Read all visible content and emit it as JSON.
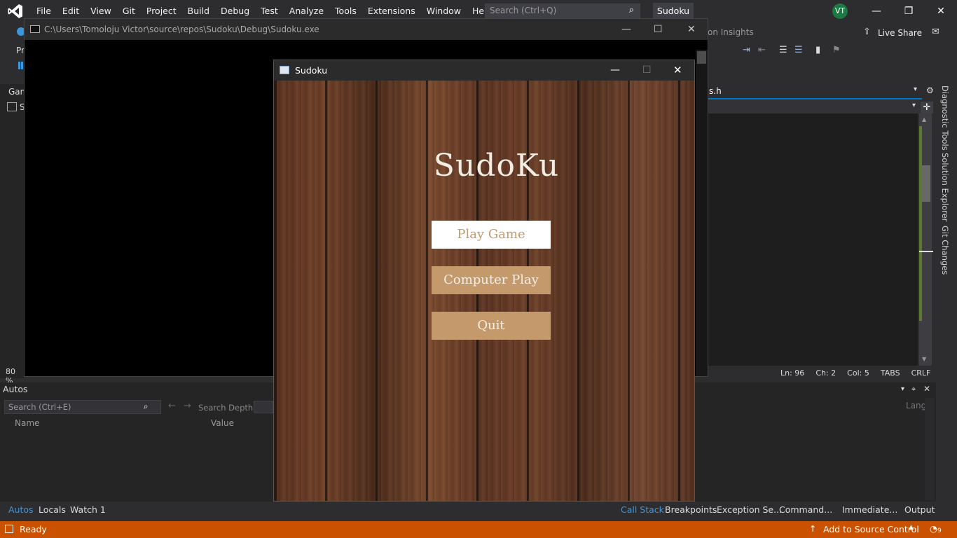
{
  "vs": {
    "menu": [
      "File",
      "Edit",
      "View",
      "Git",
      "Project",
      "Build",
      "Debug",
      "Test",
      "Analyze",
      "Tools",
      "Extensions",
      "Window",
      "Help"
    ],
    "search_placeholder": "Search (Ctrl+Q)",
    "project_title": "Sudoku",
    "user_initials": "VT",
    "live_share": "Live Share",
    "insights_label": "on Insights",
    "editor_tab": "s.h",
    "side_tabs": [
      "Diagnostic Tools",
      "Solution Explorer",
      "Git Changes"
    ],
    "zoom": "80 %",
    "status_line": {
      "ln": "Ln: 96",
      "ch": "Ch: 2",
      "col": "Col: 5",
      "tabs": "TABS",
      "crlf": "CRLF"
    },
    "autos": {
      "title": "Autos",
      "search_placeholder": "Search (Ctrl+E)",
      "search_depth": "Search Depth:",
      "col_name": "Name",
      "col_value": "Value",
      "col_lang": "Lang"
    },
    "bottom_tabs_left": [
      "Autos",
      "Locals",
      "Watch 1"
    ],
    "bottom_tabs_right": [
      "Call Stack",
      "Breakpoints",
      "Exception Se...",
      "Command...",
      "Immediate...",
      "Output"
    ],
    "status": {
      "ready": "Ready",
      "source_control": "Add to Source Control",
      "notifications": "9"
    },
    "left_fragments": {
      "gam": "Gam",
      "s": "S",
      "pr": "Pr"
    },
    "colors": {
      "accent": "#007acc",
      "status_bar": "#ca5100",
      "background": "#2d2d30"
    }
  },
  "console": {
    "path": "C:\\Users\\Tomoloju Victor\\source\\repos\\Sudoku\\Debug\\Sudoku.exe"
  },
  "sudoku": {
    "window_title": "Sudoku",
    "game_title": "SudoKu",
    "buttons": [
      "Play Game",
      "Computer Play",
      "Quit"
    ],
    "colors": {
      "button_tan": "#c49a6c",
      "button_selected": "#ffffff",
      "wood": "#5a3220"
    }
  }
}
